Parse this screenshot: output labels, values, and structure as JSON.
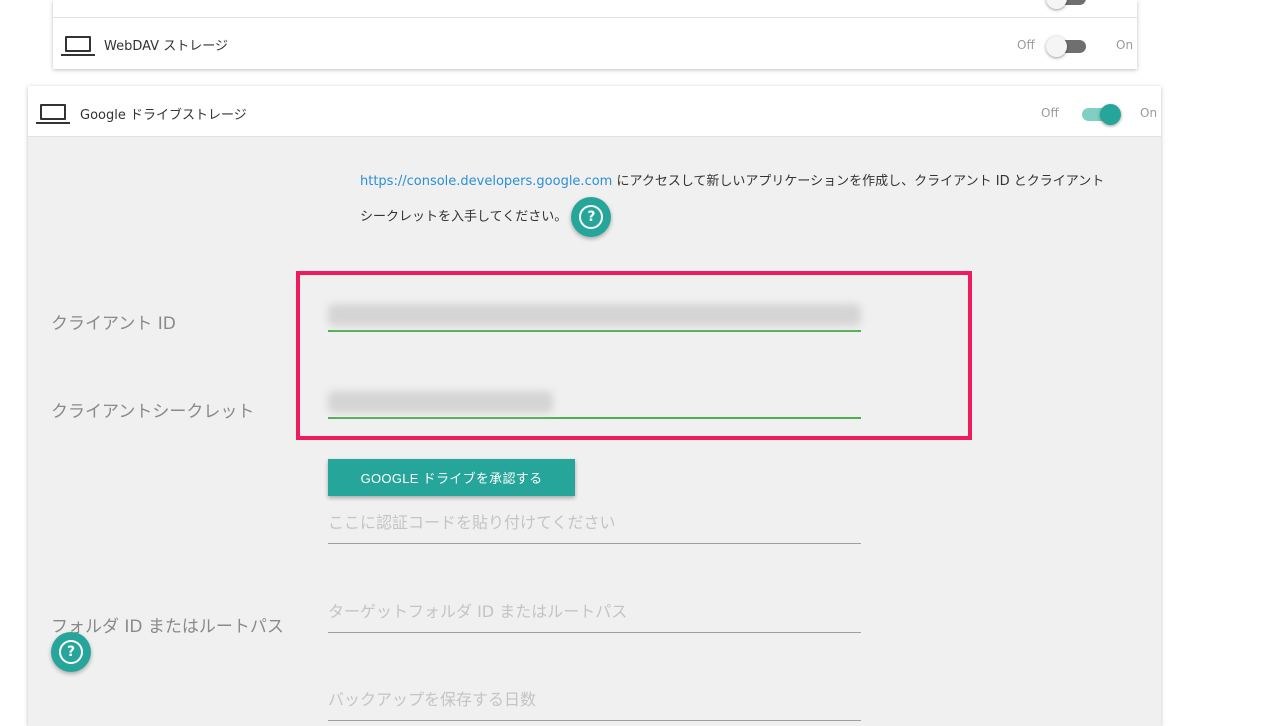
{
  "webdav": {
    "label": "WebDAV ストレージ",
    "off_label": "Off",
    "on_label": "On",
    "enabled": false
  },
  "gdrive": {
    "label": "Google ドライブストレージ",
    "off_label": "Off",
    "on_label": "On",
    "enabled": true,
    "info_link": "https://console.developers.google.com",
    "info_text": " にアクセスして新しいアプリケーションを作成し、クライアント ID とクライアント シークレットを入手してください。",
    "client_id_label": "クライアント ID",
    "client_secret_label": "クライアントシークレット",
    "authorize_button": "GOOGLE ドライブを承認する",
    "auth_code_placeholder": "ここに認証コードを貼り付けてください",
    "folder_label": "フォルダ ID またはルートパス",
    "folder_placeholder": "ターゲットフォルダ ID またはルートパス",
    "days_placeholder": "バックアップを保存する日数"
  },
  "icons": {
    "device": "laptop-icon",
    "help": "help-icon"
  },
  "colors": {
    "accent": "#26a69a",
    "highlight": "#ee1c5c",
    "link": "#2a8fd6",
    "valid_underline": "#4caf50"
  }
}
